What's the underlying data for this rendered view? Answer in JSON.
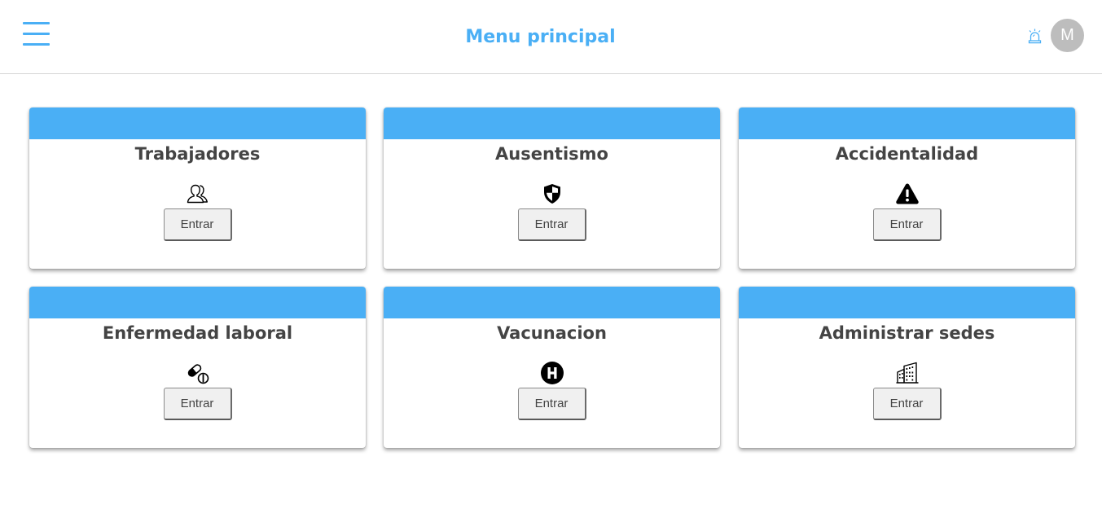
{
  "header": {
    "title": "Menu principal",
    "menu_icon": "hamburger-menu-icon",
    "alarm_icon": "alarm-siren-icon",
    "avatar_initial": "M",
    "accent_color": "#4aaff5",
    "avatar_color": "#bdbdbd"
  },
  "cards": [
    {
      "title": "Trabajadores",
      "icon": "users-icon",
      "button": "Entrar"
    },
    {
      "title": "Ausentismo",
      "icon": "shield-icon",
      "button": "Entrar"
    },
    {
      "title": "Accidentalidad",
      "icon": "warning-triangle-icon",
      "button": "Entrar"
    },
    {
      "title": "Enfermedad laboral",
      "icon": "pills-icon",
      "button": "Entrar"
    },
    {
      "title": "Vacunacion",
      "icon": "hospital-h-icon",
      "button": "Entrar"
    },
    {
      "title": "Administrar sedes",
      "icon": "building-icon",
      "button": "Entrar"
    }
  ]
}
